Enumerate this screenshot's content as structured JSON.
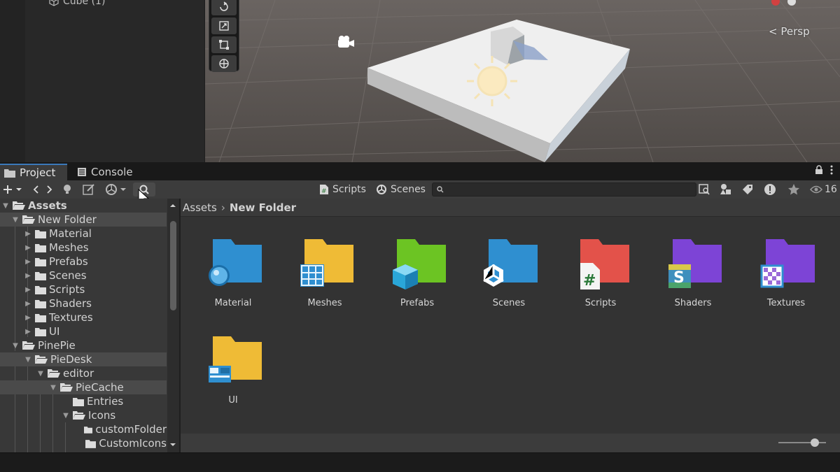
{
  "hierarchy": {
    "row_label": "Cube (1)"
  },
  "scene": {
    "persp_label": "Persp"
  },
  "tabs": {
    "project": "Project",
    "console": "Console"
  },
  "toolbar": {
    "scripts_filter": "Scripts",
    "scenes_filter": "Scenes",
    "search_placeholder": "",
    "hidden_count": "16"
  },
  "breadcrumb": {
    "root": "Assets",
    "current": "New Folder"
  },
  "tree": {
    "assets": "Assets",
    "new_folder": "New Folder",
    "material": "Material",
    "meshes": "Meshes",
    "prefabs": "Prefabs",
    "scenes": "Scenes",
    "scripts": "Scripts",
    "shaders": "Shaders",
    "textures": "Textures",
    "ui": "UI",
    "pinepie": "PinePie",
    "piedesk": "PieDesk",
    "editor": "editor",
    "piecache": "PieCache",
    "entries": "Entries",
    "icons": "Icons",
    "customfolder": "customFolder",
    "customicons": "CustomIcons"
  },
  "grid": {
    "items": [
      {
        "label": "Material",
        "color": "#2f8fd0",
        "badge": "sphere"
      },
      {
        "label": "Meshes",
        "color": "#efbb36",
        "badge": "grid"
      },
      {
        "label": "Prefabs",
        "color": "#6cc423",
        "badge": "cube"
      },
      {
        "label": "Scenes",
        "color": "#2f8fd0",
        "badge": "unity"
      },
      {
        "label": "Scripts",
        "color": "#e3524a",
        "badge": "hash"
      },
      {
        "label": "Shaders",
        "color": "#7d44d6",
        "badge": "shader"
      },
      {
        "label": "Textures",
        "color": "#7d44d6",
        "badge": "checker"
      },
      {
        "label": "UI",
        "color": "#efbb36",
        "badge": "ui"
      }
    ]
  }
}
